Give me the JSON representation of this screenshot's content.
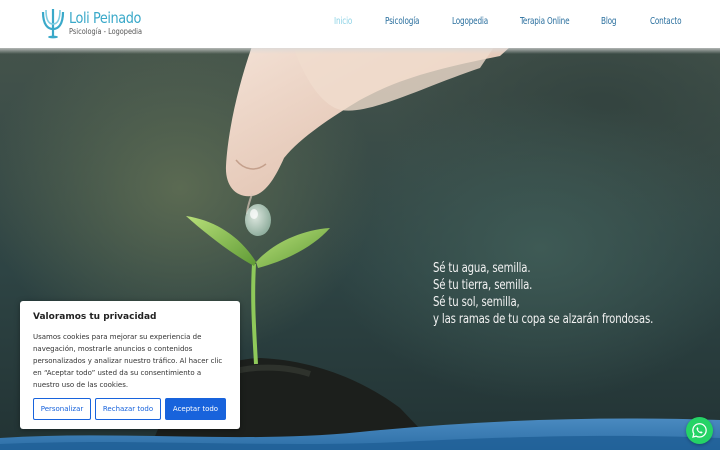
{
  "brand": {
    "name": "Loli Peinado",
    "tagline": "Psicología - Logopedia",
    "color": "#3aa9c9"
  },
  "nav": {
    "items": [
      {
        "label": "Inicio",
        "active": true
      },
      {
        "label": "Psicología",
        "active": false
      },
      {
        "label": "Logopedia",
        "active": false
      },
      {
        "label": "Terapia Online",
        "active": false
      },
      {
        "label": "Blog",
        "active": false
      },
      {
        "label": "Contacto",
        "active": false
      }
    ],
    "color": "#2a6f9e",
    "active_color": "#8fd3e6"
  },
  "hero": {
    "quote_lines": [
      "Sé tu agua, semilla.",
      "Sé tu tierra, semilla.",
      "Sé tu sol, semilla,",
      "y las ramas de tu copa se alzarán frondosas."
    ]
  },
  "cookie": {
    "title": "Valoramos tu privacidad",
    "text": "Usamos cookies para mejorar su experiencia de navegación, mostrarle anuncios o contenidos personalizados y analizar nuestro tráfico. Al hacer clic en “Aceptar todo” usted da su consentimiento a nuestro uso de las cookies.",
    "buttons": {
      "customize": "Personalizar",
      "reject": "Rechazar todo",
      "accept": "Aceptar todo"
    },
    "accent": "#1863dc"
  },
  "whatsapp": {
    "icon": "whatsapp-icon",
    "color": "#25d366"
  }
}
